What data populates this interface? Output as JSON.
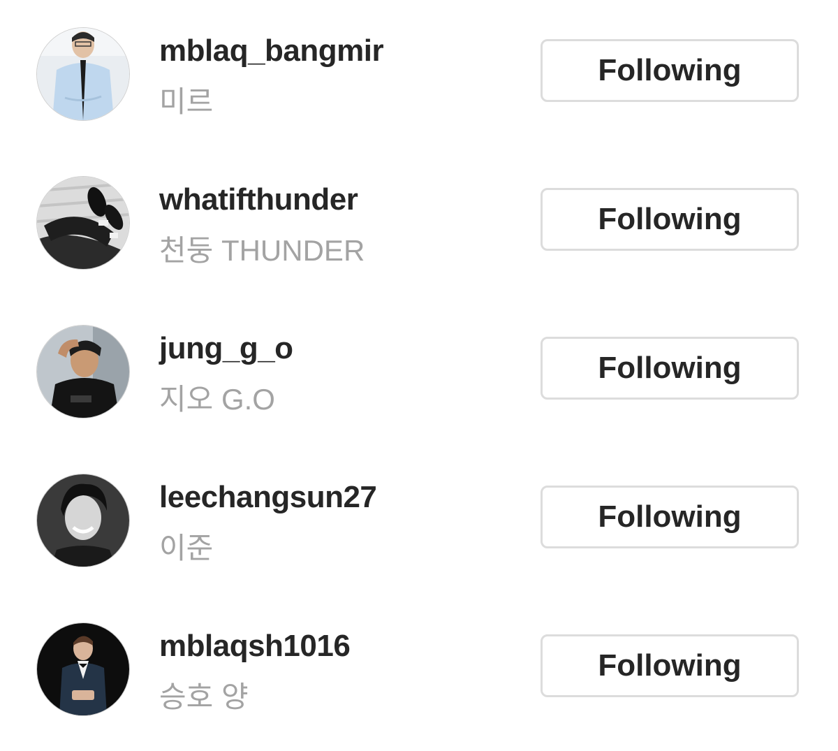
{
  "following_list": [
    {
      "username": "mblaq_bangmir",
      "full_name": "미르",
      "button_label": "Following",
      "avatar": "profile-photo-man-white-shirt-tie"
    },
    {
      "username": "whatifthunder",
      "full_name": "천둥 THUNDER",
      "button_label": "Following",
      "avatar": "profile-photo-crossed-legs-shoes"
    },
    {
      "username": "jung_g_o",
      "full_name": "지오 G.O",
      "button_label": "Following",
      "avatar": "profile-photo-man-black-tshirt"
    },
    {
      "username": "leechangsun27",
      "full_name": "이준",
      "button_label": "Following",
      "avatar": "profile-photo-smiling-man-bw"
    },
    {
      "username": "mblaqsh1016",
      "full_name": "승호 양",
      "button_label": "Following",
      "avatar": "profile-photo-man-suit-dark"
    }
  ]
}
